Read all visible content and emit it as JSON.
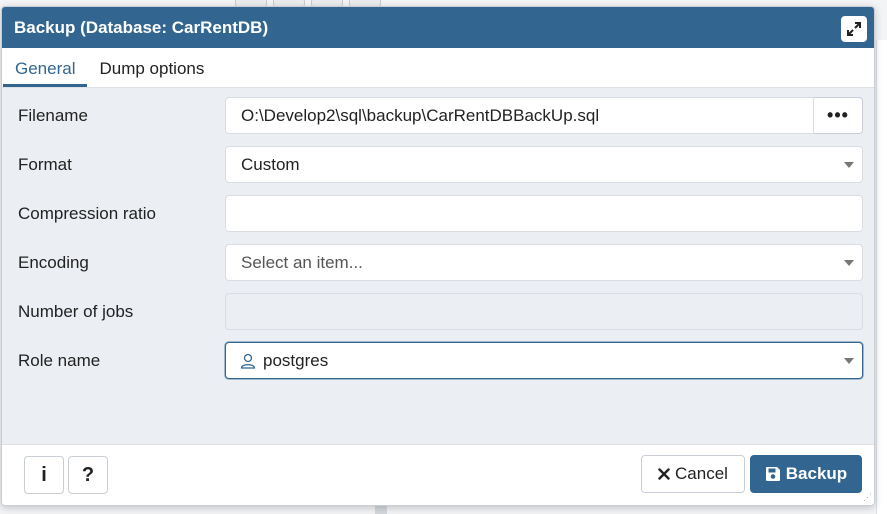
{
  "dialog": {
    "title": "Backup (Database: CarRentDB)",
    "tabs": [
      {
        "label": "General",
        "active": true
      },
      {
        "label": "Dump options",
        "active": false
      }
    ]
  },
  "form": {
    "filename": {
      "label": "Filename",
      "value": "O:\\Develop2\\sql\\backup\\CarRentDBBackUp.sql",
      "browse_label": "•••"
    },
    "format": {
      "label": "Format",
      "value": "Custom"
    },
    "compression": {
      "label": "Compression ratio",
      "value": ""
    },
    "encoding": {
      "label": "Encoding",
      "placeholder": "Select an item..."
    },
    "jobs": {
      "label": "Number of jobs",
      "value": ""
    },
    "role": {
      "label": "Role name",
      "value": "postgres",
      "icon": "user-icon"
    }
  },
  "footer": {
    "info_label": "i",
    "help_label": "?",
    "cancel_label": "Cancel",
    "backup_label": "Backup"
  },
  "colors": {
    "accent": "#326690",
    "background": "#ebeef3"
  }
}
